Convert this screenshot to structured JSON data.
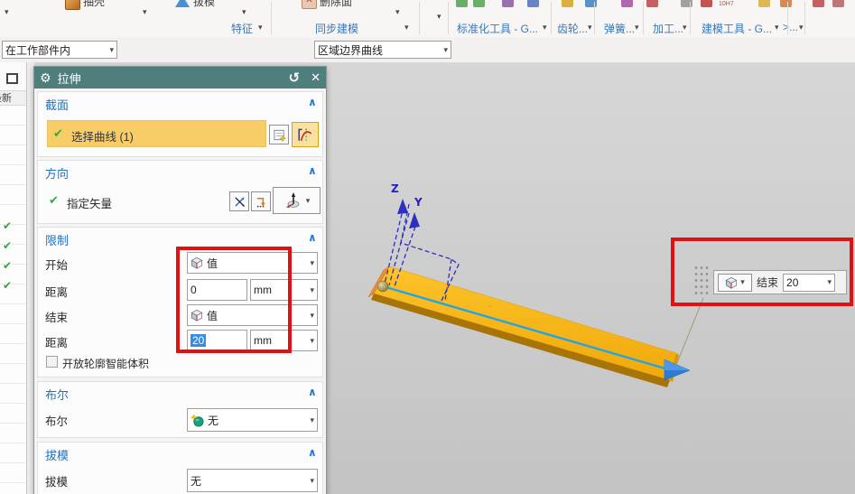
{
  "icons": {
    "gear": "⚙",
    "reset": "↺",
    "close": "✕",
    "check": "✔",
    "collapse": "∧",
    "caret": "▾"
  },
  "ribbon": {
    "tools": [
      {
        "label": "抽壳"
      },
      {
        "label": "拔模"
      },
      {
        "label": "删除面"
      }
    ],
    "groups": [
      {
        "label": "特征"
      },
      {
        "label": "同步建模"
      },
      {
        "label": "标准化工具 - G..."
      },
      {
        "label": "齿轮..."
      },
      {
        "label": "弹簧..."
      },
      {
        "label": "加工..."
      },
      {
        "label": "建模工具 - G..."
      },
      {
        "label": ">..."
      }
    ],
    "tolerance_text": "10H7"
  },
  "selection_bar": {
    "scope": "在工作部件内",
    "curve_rule": "区域边界曲线",
    "icons": [
      {
        "name": "assembly-constraints-icon",
        "glyph": "⊞"
      },
      {
        "name": "move-component-icon",
        "glyph": "↷"
      },
      {
        "name": "snap-point-icon",
        "glyph": "✛"
      },
      {
        "name": "rotate-point-icon",
        "glyph": "↻"
      },
      {
        "name": "tool-icon",
        "glyph": "◳"
      },
      {
        "name": "solid-wedge-icon",
        "glyph": "◆"
      },
      {
        "name": "forward-arrow-icon",
        "glyph": "⇨"
      },
      {
        "name": "point-cloud-icon",
        "glyph": "⁂"
      },
      {
        "name": "line-icon",
        "glyph": "∕"
      },
      {
        "name": "line2-icon",
        "glyph": "∕"
      },
      {
        "name": "arc-icon",
        "glyph": "∼"
      },
      {
        "name": "spline-icon",
        "glyph": "∾"
      },
      {
        "name": "axis-icon",
        "glyph": "⊥"
      },
      {
        "name": "circle-center-icon",
        "glyph": "⊙"
      },
      {
        "name": "circle-icon",
        "glyph": "◯"
      },
      {
        "name": "plus-icon",
        "glyph": "+"
      },
      {
        "name": "slash-icon",
        "glyph": "∕"
      },
      {
        "name": "face-icon",
        "glyph": "◔"
      },
      {
        "name": "grid-icon",
        "glyph": "▦"
      },
      {
        "name": "zoom-region-icon",
        "glyph": "◎"
      },
      {
        "name": "pan-window-icon",
        "glyph": "▤"
      },
      {
        "name": "refresh-icon",
        "glyph": "↻"
      }
    ]
  },
  "navigator": {
    "header": "最新"
  },
  "dialog": {
    "title": "拉伸",
    "section": {
      "header": "截面",
      "select_curve": "选择曲线 (1)"
    },
    "direction": {
      "header": "方向",
      "specify_vector": "指定矢量"
    },
    "limits": {
      "header": "限制",
      "start_label": "开始",
      "start_value": "值",
      "distance1_label": "距离",
      "distance1_value": "0",
      "distance1_unit": "mm",
      "end_label": "结束",
      "end_value": "值",
      "distance2_label": "距离",
      "distance2_value": "20",
      "distance2_unit": "mm",
      "open_profile_checkbox": "开放轮廓智能体积"
    },
    "boolean": {
      "header": "布尔",
      "label": "布尔",
      "value": "无"
    },
    "draft": {
      "header": "拔模",
      "label": "拔模",
      "value": "无"
    }
  },
  "viewport": {
    "axes": {
      "z": "Z",
      "y": "Y"
    },
    "mini_toolbar": {
      "end_label": "结束",
      "end_value": "20"
    }
  }
}
